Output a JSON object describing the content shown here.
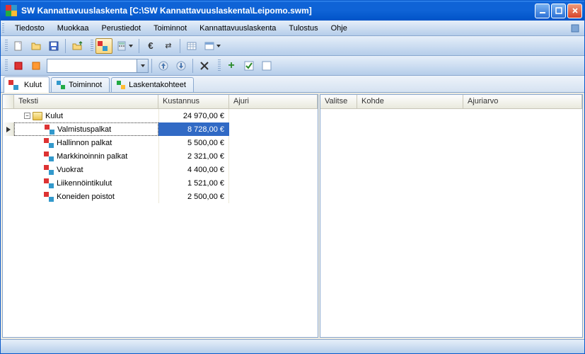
{
  "window": {
    "title": "SW Kannattavuuslaskenta [C:\\SW Kannattavuuslaskenta\\Leipomo.swm]"
  },
  "menu": {
    "items": [
      "Tiedosto",
      "Muokkaa",
      "Perustiedot",
      "Toiminnot",
      "Kannattavuuslaskenta",
      "Tulostus",
      "Ohje"
    ]
  },
  "tabs": {
    "items": [
      {
        "label": "Kulut",
        "active": true
      },
      {
        "label": "Toiminnot",
        "active": false
      },
      {
        "label": "Laskentakohteet",
        "active": false
      }
    ]
  },
  "left_panel": {
    "columns": {
      "c1": "Teksti",
      "c2": "Kustannus",
      "c3": "Ajuri"
    },
    "root": {
      "label": "Kulut",
      "cost": "24 970,00 €"
    },
    "children": [
      {
        "label": "Valmistuspalkat",
        "cost": "8 728,00 €",
        "selected": true
      },
      {
        "label": "Hallinnon palkat",
        "cost": "5 500,00 €",
        "selected": false
      },
      {
        "label": "Markkinoinnin palkat",
        "cost": "2 321,00 €",
        "selected": false
      },
      {
        "label": "Vuokrat",
        "cost": "4 400,00 €",
        "selected": false
      },
      {
        "label": "Liikennöintikulut",
        "cost": "1 521,00 €",
        "selected": false
      },
      {
        "label": "Koneiden poistot",
        "cost": "2 500,00 €",
        "selected": false
      }
    ]
  },
  "right_panel": {
    "columns": {
      "c1": "Valitse",
      "c2": "Kohde",
      "c3": "Ajuriarvo"
    }
  },
  "toolbar_icons": {
    "euro": "€",
    "plus": "+",
    "check": "✓",
    "arrows": "⇄"
  }
}
